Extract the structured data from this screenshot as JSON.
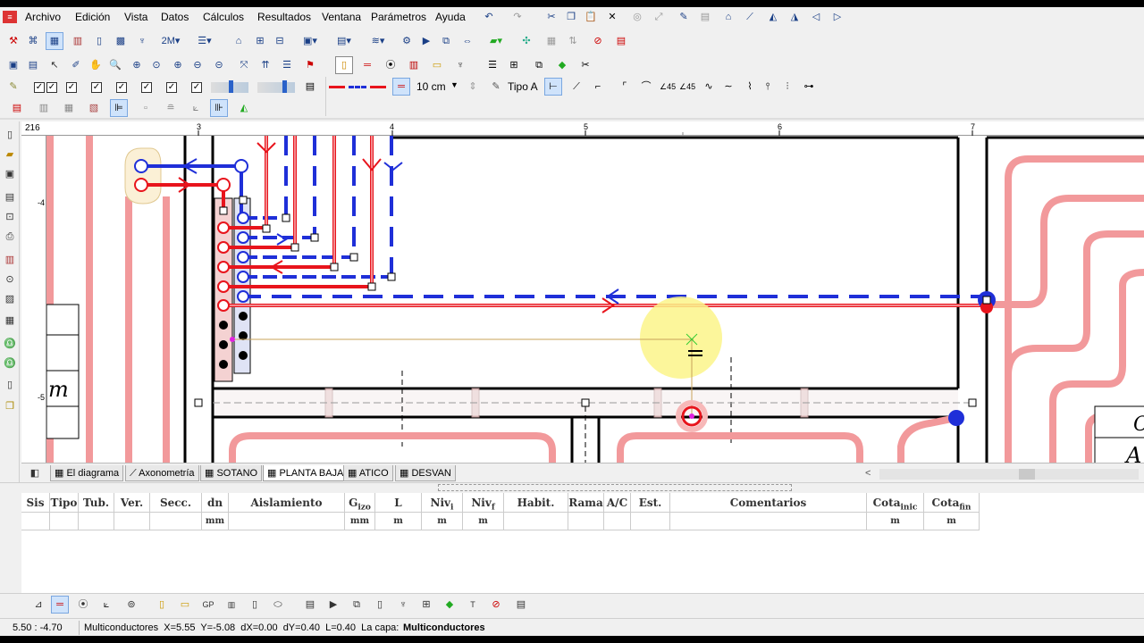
{
  "menu": {
    "items": [
      "Archivo",
      "Edición",
      "Vista",
      "Datos",
      "Cálculos",
      "Resultados",
      "Ventana",
      "Parámetros",
      "Ayuda"
    ]
  },
  "toolbar": {
    "spacing_value": "10 cm",
    "type_label": "Tipo A"
  },
  "ruler": {
    "corner": "216",
    "top_ticks": [
      "3",
      "4",
      "5",
      "6",
      "7"
    ],
    "left_ticks": [
      "-4",
      "-5"
    ]
  },
  "canvas": {
    "side_labels": [
      "m",
      "A",
      "C"
    ]
  },
  "tabs": [
    {
      "label": "El diagrama",
      "active": false
    },
    {
      "label": "Axonometría",
      "active": false
    },
    {
      "label": "SOTANO",
      "active": false
    },
    {
      "label": "PLANTA BAJA",
      "active": true
    },
    {
      "label": "ATICO",
      "active": false
    },
    {
      "label": "DESVAN",
      "active": false
    }
  ],
  "grid": {
    "columns": [
      {
        "label": "Sis",
        "sub": "",
        "unit": ""
      },
      {
        "label": "Tipo",
        "sub": "",
        "unit": ""
      },
      {
        "label": "Tub.",
        "sub": "",
        "unit": ""
      },
      {
        "label": "Ver.",
        "sub": "",
        "unit": ""
      },
      {
        "label": "Secc.",
        "sub": "",
        "unit": ""
      },
      {
        "label": "dn",
        "sub": "",
        "unit": "mm"
      },
      {
        "label": "Aislamiento",
        "sub": "",
        "unit": ""
      },
      {
        "label": "G",
        "sub": "izo",
        "unit": "mm"
      },
      {
        "label": "L",
        "sub": "",
        "unit": "m"
      },
      {
        "label": "Niv",
        "sub": "i",
        "unit": "m"
      },
      {
        "label": "Niv",
        "sub": "f",
        "unit": "m"
      },
      {
        "label": "Habit.",
        "sub": "",
        "unit": ""
      },
      {
        "label": "Rama",
        "sub": "",
        "unit": ""
      },
      {
        "label": "A/C",
        "sub": "",
        "unit": ""
      },
      {
        "label": "Est.",
        "sub": "",
        "unit": ""
      },
      {
        "label": "Comentarios",
        "sub": "",
        "unit": ""
      },
      {
        "label": "Cota",
        "sub": "inic",
        "unit": "m"
      },
      {
        "label": "Cota",
        "sub": "fin",
        "unit": "m"
      }
    ]
  },
  "status": {
    "coords": "5.50 : -4.70",
    "message": "Multiconductores  X=5.55  Y=-5.08  dX=0.00  dY=0.40  L=0.40  La capa:",
    "layer": "Multiconductores"
  },
  "colors": {
    "pipe_red": "#e8141c",
    "pipe_blue": "#1f2fd8",
    "floor_heating_pink": "#f2999b",
    "cursor_highlight": "#fbf58a"
  }
}
